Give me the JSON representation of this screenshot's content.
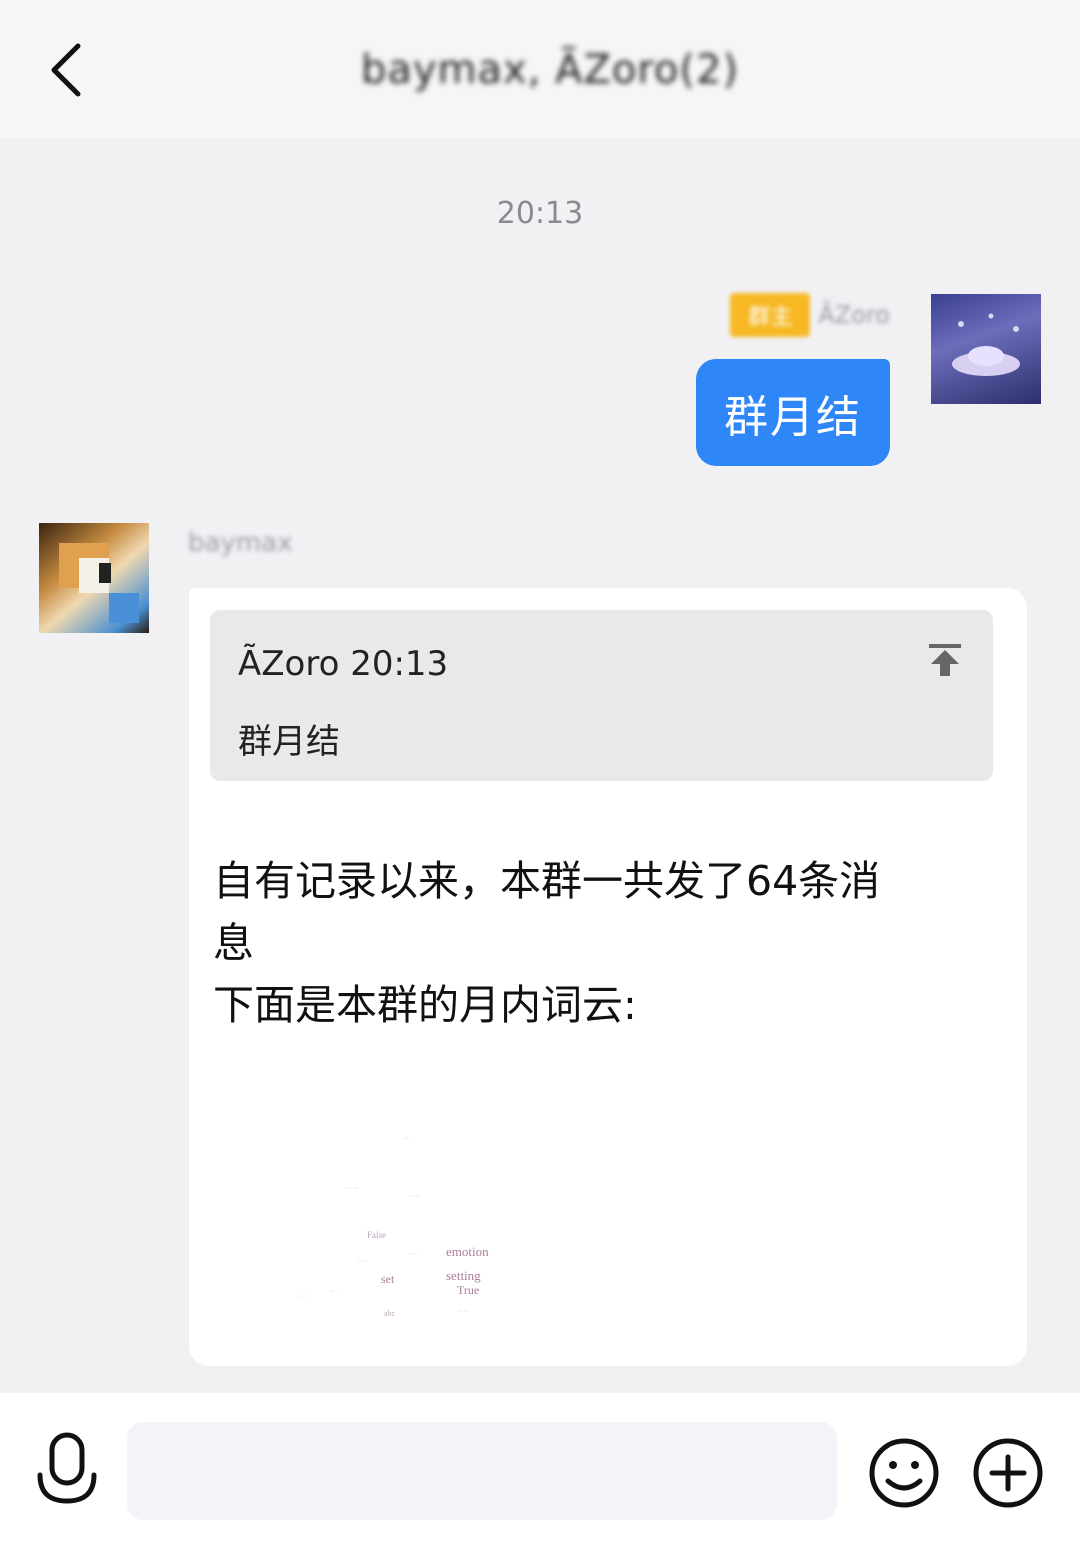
{
  "header": {
    "title": "baymax, ÃZoro(2)"
  },
  "chat": {
    "timestamp": "20:13",
    "self": {
      "badge": "群主",
      "sender_name": "ÃZoro",
      "message": "群月结"
    },
    "bot": {
      "sender_name": "baymax",
      "quote": {
        "header": "ÃZoro 20:13",
        "text": "群月结"
      },
      "lines": [
        "自有记录以来，本群一共发了64条消",
        "息",
        "下面是本群的月内词云:"
      ],
      "wordcloud_words": [
        "emotion",
        "setting",
        "True",
        "set",
        "False",
        "abc"
      ]
    }
  },
  "input_bar": {
    "placeholder": ""
  },
  "colors": {
    "accent_blue": "#2f86f6",
    "badge_yellow": "#f7b824",
    "background": "#f1f1f4"
  },
  "icons": [
    "back-arrow-icon",
    "jump-to-message-icon",
    "microphone-icon",
    "emoji-icon",
    "plus-icon"
  ]
}
